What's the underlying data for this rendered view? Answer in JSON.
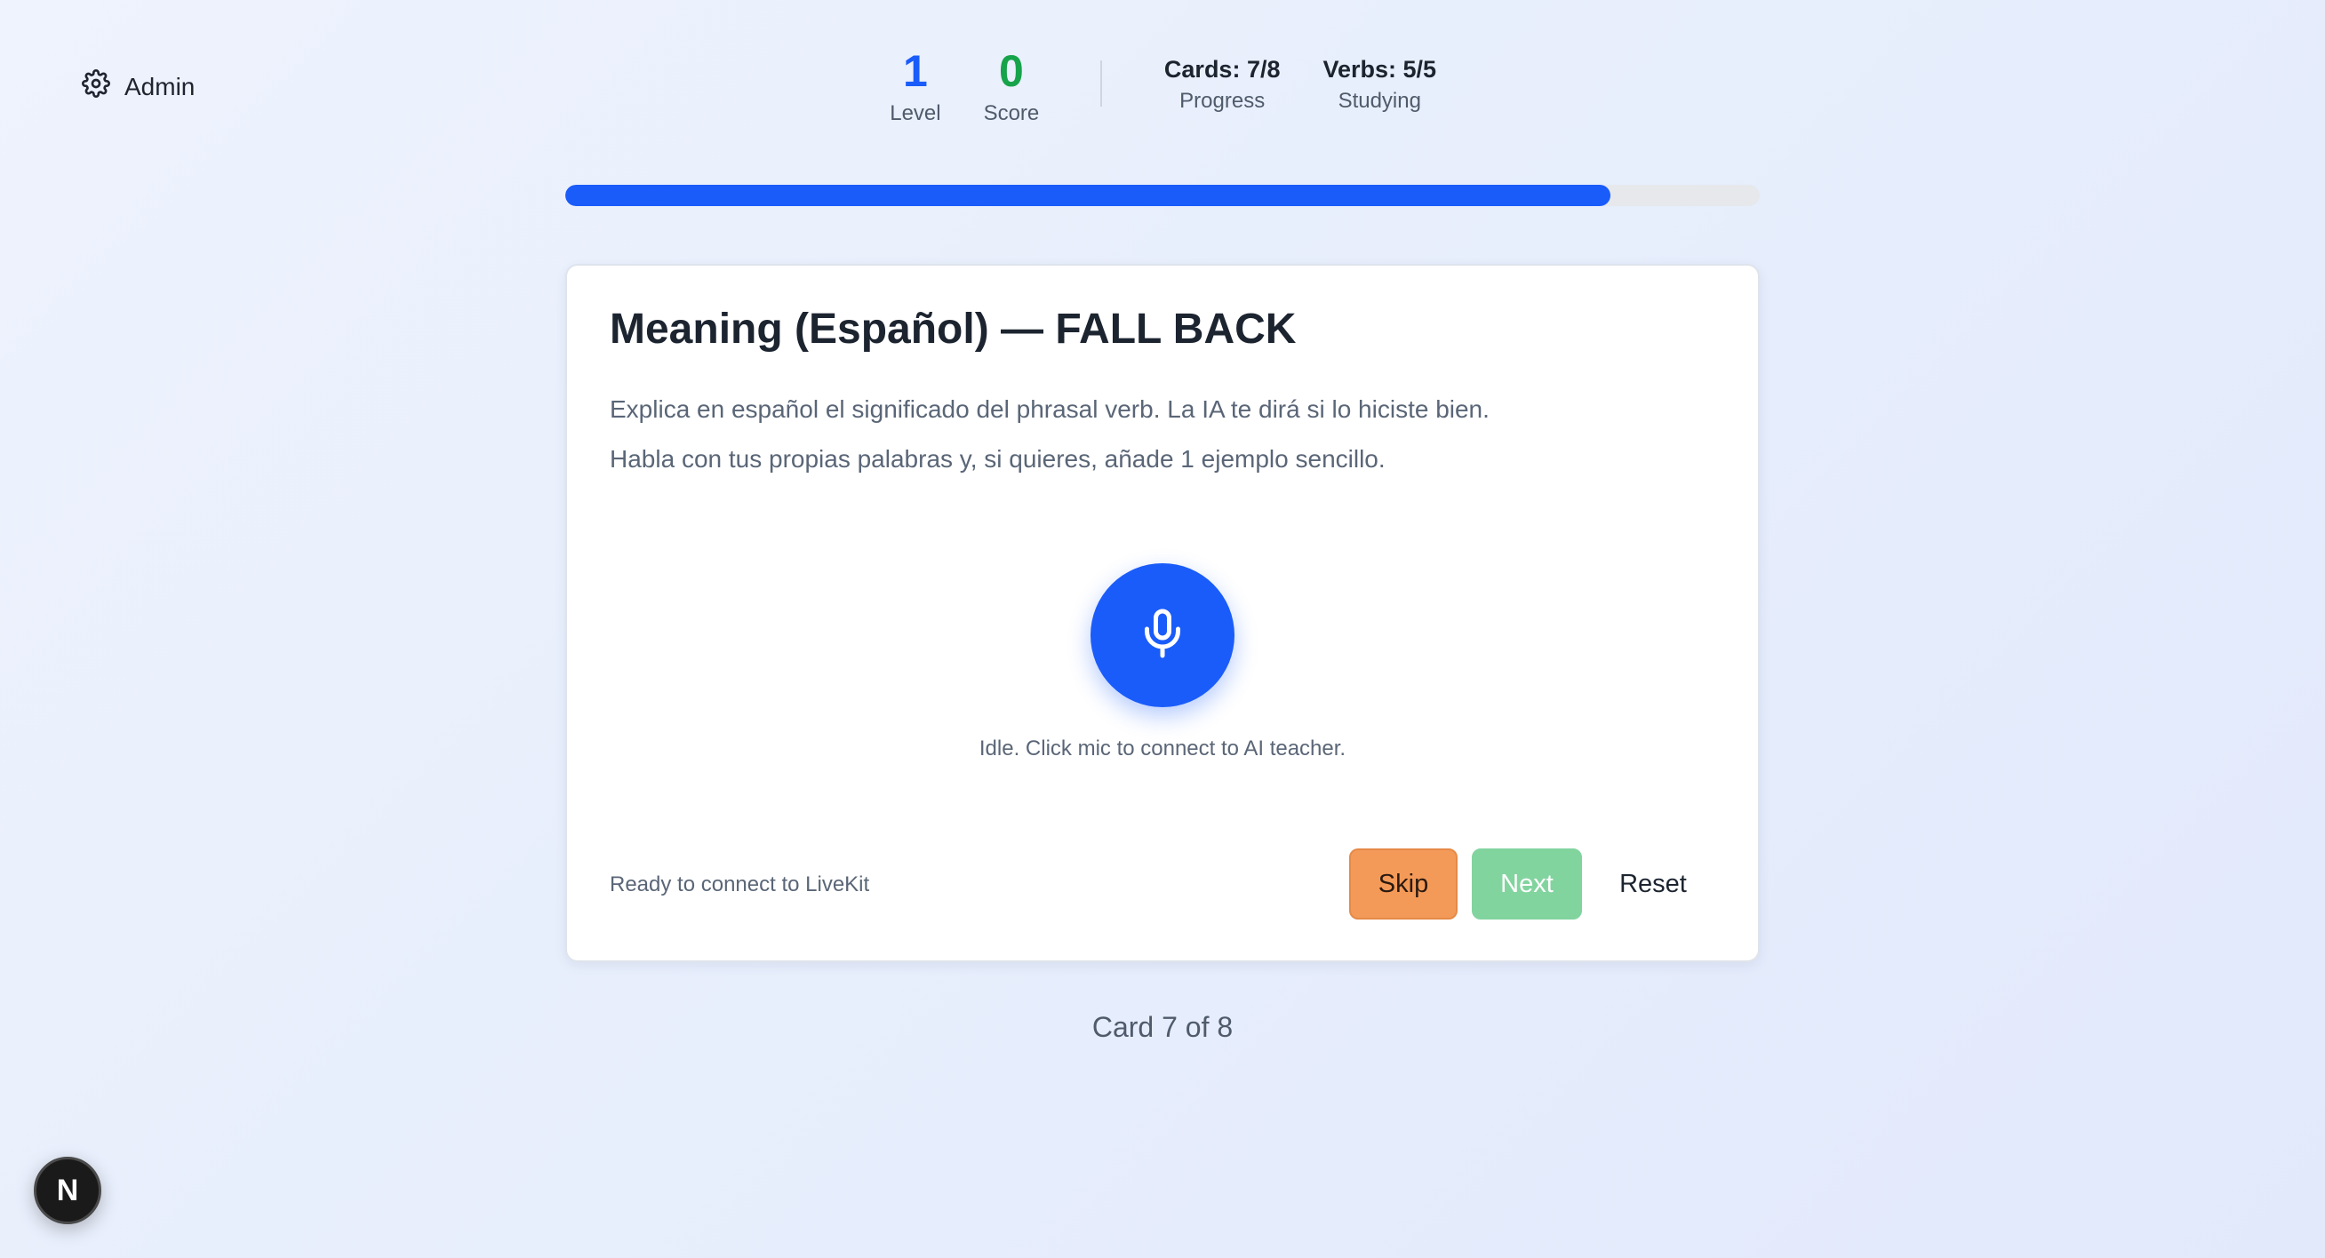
{
  "header": {
    "admin_label": "Admin",
    "stats": {
      "level": {
        "value": "1",
        "label": "Level",
        "color": "#1a5cfa"
      },
      "score": {
        "value": "0",
        "label": "Score",
        "color": "#16a34a"
      },
      "cards": {
        "value": "Cards: 7/8",
        "label": "Progress"
      },
      "verbs": {
        "value": "Verbs: 5/5",
        "label": "Studying"
      }
    }
  },
  "progress": {
    "fraction": 0.875,
    "color": "#1a5cfa"
  },
  "card": {
    "title": "Meaning (Español) — FALL BACK",
    "instruction_1": "Explica en español el significado del phrasal verb. La IA te dirá si lo hiciste bien.",
    "instruction_2": "Habla con tus propias palabras y, si quieres, añade 1 ejemplo sencillo.",
    "mic_icon": "microphone-icon",
    "mic_status": "Idle. Click mic to connect to AI teacher.",
    "connection_status": "Ready to connect to LiveKit",
    "buttons": {
      "skip": "Skip",
      "next": "Next",
      "reset": "Reset"
    }
  },
  "footer": {
    "counter": "Card 7 of 8"
  },
  "badge": {
    "letter": "N"
  }
}
